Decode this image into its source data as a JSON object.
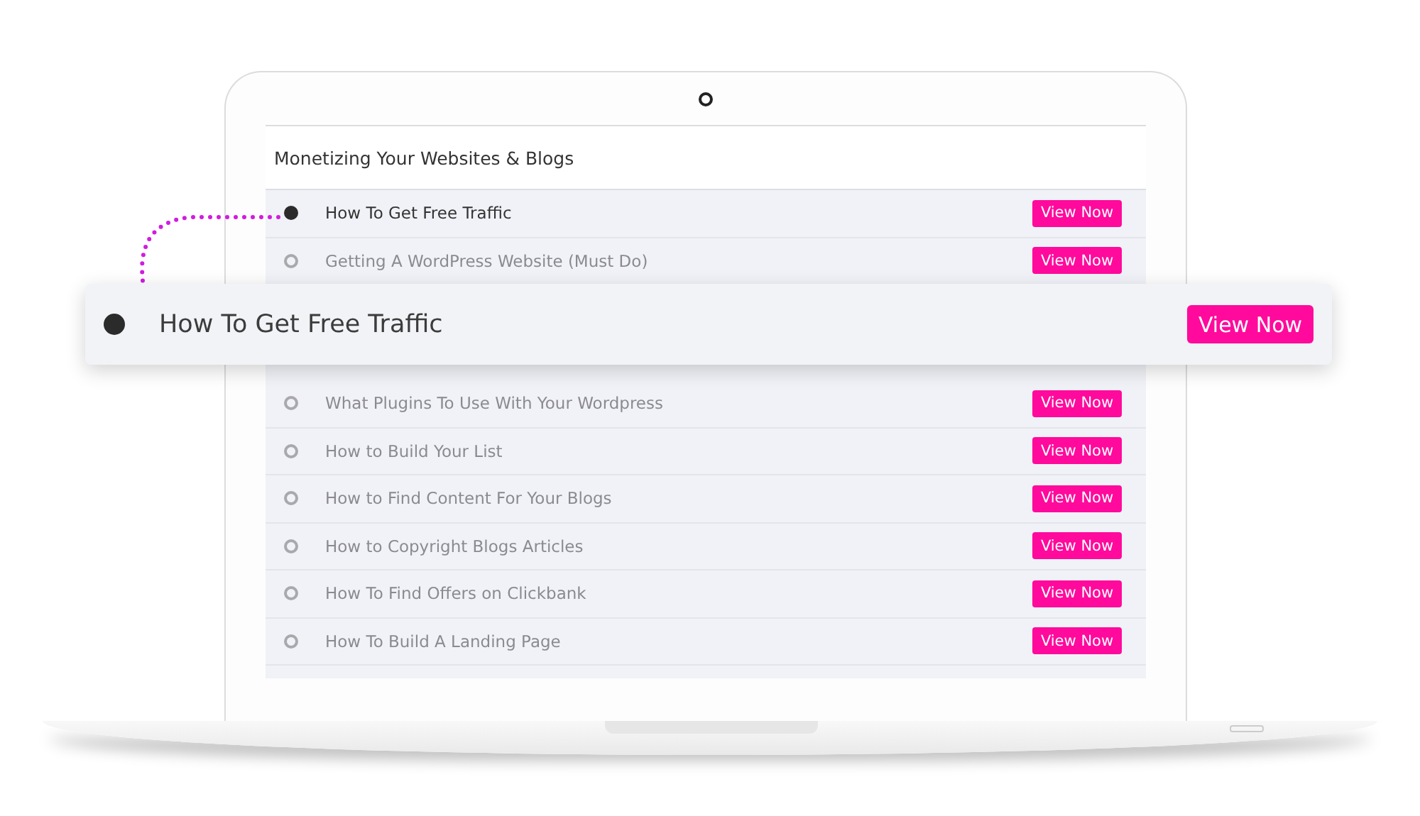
{
  "course": {
    "title": "Monetizing Your Websites & Blogs"
  },
  "lessons": [
    {
      "title": "How To Get Free Traffic",
      "button": "View Now",
      "selected": true
    },
    {
      "title": "Getting A WordPress Website (Must Do)",
      "button": "View Now",
      "selected": false
    },
    {
      "title": "What Plugins To Use With Your Wordpress",
      "button": "View Now",
      "selected": false
    },
    {
      "title": "How to Build Your List",
      "button": "View Now",
      "selected": false
    },
    {
      "title": "How to Find Content For Your Blogs",
      "button": "View Now",
      "selected": false
    },
    {
      "title": "How to Copyright Blogs Articles",
      "button": "View Now",
      "selected": false
    },
    {
      "title": "How To Find Offers on Clickbank",
      "button": "View Now",
      "selected": false
    },
    {
      "title": "How To Build A Landing Page",
      "button": "View Now",
      "selected": false
    }
  ],
  "callout": {
    "title": "How To Get Free Traffic",
    "button": "View Now"
  }
}
